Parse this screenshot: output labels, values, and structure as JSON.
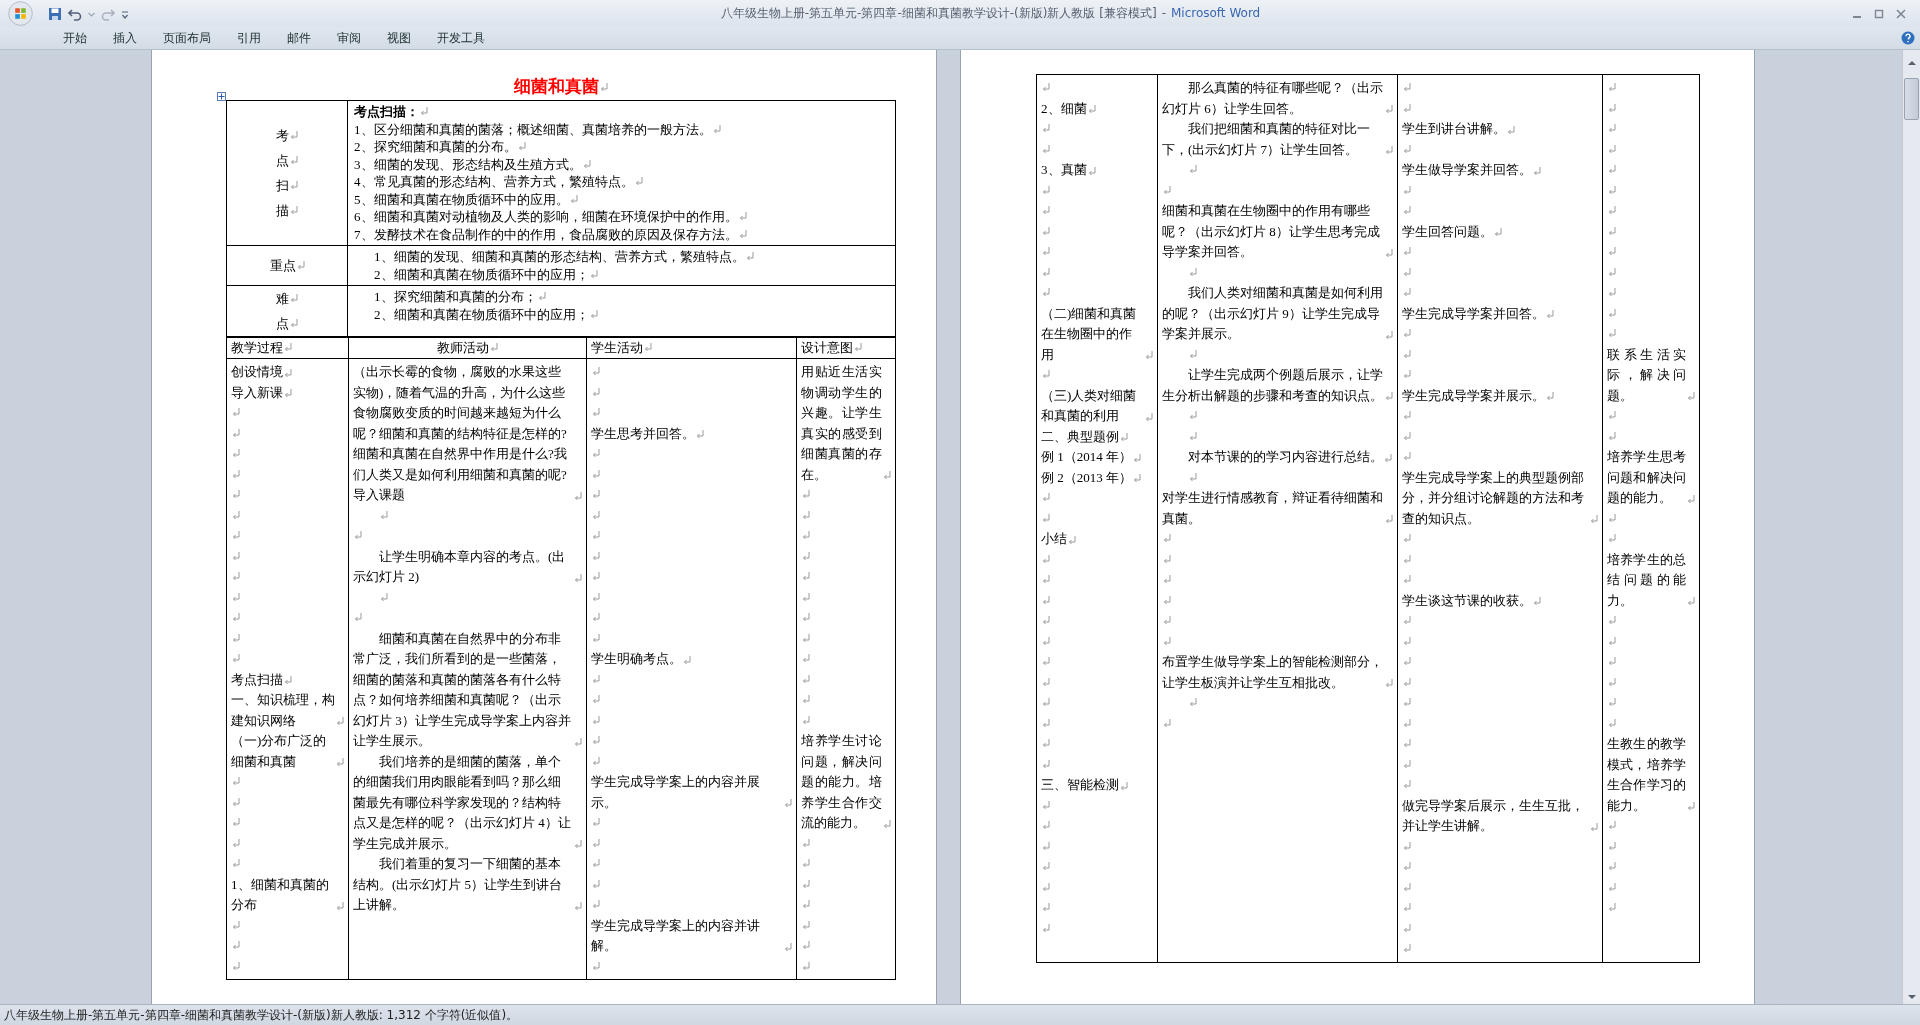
{
  "window": {
    "document_title": "八年级生物上册-第五单元-第四章-细菌和真菌教学设计-(新版)新人教版 [兼容模式]",
    "separator": "-",
    "app_name": "Microsoft Word"
  },
  "ribbon_tabs": [
    "开始",
    "插入",
    "页面布局",
    "引用",
    "邮件",
    "审阅",
    "视图",
    "开发工具"
  ],
  "document": {
    "title": "细菌和真菌",
    "summary_table": [
      {
        "label": [
          "考",
          "点",
          "扫",
          "描"
        ],
        "heading": "考点扫描：",
        "items": [
          "1、区分细菌和真菌的菌落；概述细菌、真菌培养的一般方法。",
          "2、探究细菌和真菌的分布。",
          "3、细菌的发现、形态结构及生殖方式。",
          "4、常见真菌的形态结构、营养方式，繁殖特点。",
          "5、细菌和真菌在物质循环中的应用。",
          "6、细菌和真菌对动植物及人类的影响，细菌在环境保护中的作用。",
          "7、发酵技术在食品制作的中的作用，食品腐败的原因及保存方法。"
        ]
      },
      {
        "label": [
          "重点"
        ],
        "items": [
          "1、细菌的发现、细菌和真菌的形态结构、营养方式，繁殖特点。",
          "2、细菌和真菌在物质循环中的应用；"
        ]
      },
      {
        "label": [
          "难",
          "点"
        ],
        "items": [
          "1、探究细菌和真菌的分布；",
          "2、细菌和真菌在物质循环中的应用；"
        ]
      }
    ],
    "lesson_table": {
      "columns": [
        "教学过程",
        "教师活动",
        "学生活动",
        "设计意图"
      ],
      "pages": [
        {
          "process": [
            {
              "text": "创设情境",
              "indent": false
            },
            {
              "text": "导入新课",
              "indent": false
            },
            {
              "indent": false
            },
            {
              "indent": false
            },
            {
              "indent": false
            },
            {
              "indent": false
            },
            {
              "indent": false
            },
            {
              "indent": false
            },
            {
              "indent": false
            },
            {
              "indent": false
            },
            {
              "indent": false
            },
            {
              "indent": false
            },
            {
              "indent": false
            },
            {
              "indent": false
            },
            {
              "indent": false
            },
            {
              "text": "考点扫描",
              "indent": false
            },
            {
              "text": "一、知识梳理，构建知识网络",
              "indent": false
            },
            {
              "text": "（一)分布广泛的细菌和真菌",
              "indent": false
            },
            {
              "indent": false
            },
            {
              "indent": false
            },
            {
              "indent": false
            },
            {
              "indent": false
            },
            {
              "indent": false
            },
            {
              "text": "1、细菌和真菌的分布",
              "indent": false
            },
            {
              "indent": false
            },
            {
              "indent": false
            },
            {
              "indent": false
            }
          ],
          "teacher": [
            {
              "text": "（出示长霉的食物，腐败的水果这些实物)，随着气温的升高，为什么这些食物腐败变质的时间越来越短为什么呢？细菌和真菌的结构特征是怎样的?细菌和真菌在自然界中作用是什么?我们人类又是如何利用细菌和真菌的呢?导入课题",
              "indent": false
            },
            {
              "indent": true
            },
            {
              "indent": false
            },
            {
              "text": "让学生明确本章内容的考点。(出示幻灯片 2)",
              "indent": true
            },
            {
              "indent": true
            },
            {
              "indent": false
            },
            {
              "text": "细菌和真菌在自然界中的分布非常广泛，我们所看到的是一些菌落，细菌的菌落和真菌的菌落各有什么特点？如何培养细菌和真菌呢？（出示幻灯片 3）让学生完成导学案上内容并让学生展示。",
              "indent": true
            },
            {
              "text": "我们培养的是细菌的菌落，单个的细菌我们用肉眼能看到吗？那么细菌最先有哪位科学家发现的？结构特点又是怎样的呢？（出示幻灯片 4）让学生完成并展示。",
              "indent": true
            },
            {
              "text": "我们着重的复习一下细菌的基本结构。(出示幻灯片 5）让学生到讲台上讲解。",
              "indent": true
            }
          ],
          "student": [
            {
              "indent": false
            },
            {
              "indent": false
            },
            {
              "indent": false
            },
            {
              "text": "学生思考并回答。",
              "indent": false
            },
            {
              "indent": false
            },
            {
              "indent": false
            },
            {
              "indent": false
            },
            {
              "indent": false
            },
            {
              "indent": false
            },
            {
              "indent": false
            },
            {
              "indent": false
            },
            {
              "indent": false
            },
            {
              "indent": false
            },
            {
              "indent": false
            },
            {
              "text": "学生明确考点。",
              "indent": false
            },
            {
              "indent": false
            },
            {
              "indent": false
            },
            {
              "indent": false
            },
            {
              "indent": false
            },
            {
              "indent": false
            },
            {
              "text": "学生完成导学案上的内容并展示。",
              "indent": false
            },
            {
              "indent": false
            },
            {
              "indent": false
            },
            {
              "indent": false
            },
            {
              "indent": false
            },
            {
              "indent": false
            },
            {
              "text": "学生完成导学案上的内容并讲解。",
              "indent": false
            },
            {
              "indent": false
            }
          ],
          "design": [
            {
              "text": "用贴近生活实物调动学生的兴趣。让学生真实的感受到细菌真菌的存在。",
              "indent": false
            },
            {
              "indent": false
            },
            {
              "indent": false
            },
            {
              "indent": false
            },
            {
              "indent": false
            },
            {
              "indent": false
            },
            {
              "indent": false
            },
            {
              "indent": false
            },
            {
              "indent": false
            },
            {
              "indent": false
            },
            {
              "indent": false
            },
            {
              "indent": false
            },
            {
              "indent": false
            },
            {
              "text": "培养学生讨论问题，解决问题的能力。培养学生合作交流的能力。",
              "indent": false
            },
            {
              "indent": false
            },
            {
              "indent": false
            },
            {
              "indent": false
            },
            {
              "indent": false
            },
            {
              "indent": false
            },
            {
              "indent": false
            },
            {
              "indent": false
            }
          ]
        },
        {
          "process": [
            {
              "indent": false
            },
            {
              "text": "2、细菌",
              "indent": false
            },
            {
              "indent": false
            },
            {
              "indent": false
            },
            {
              "text": "3、真菌",
              "indent": false
            },
            {
              "indent": false
            },
            {
              "indent": false
            },
            {
              "indent": false
            },
            {
              "indent": false
            },
            {
              "indent": false
            },
            {
              "indent": false
            },
            {
              "text": "（二)细菌和真菌在生物圈中的作用",
              "indent": false
            },
            {
              "indent": false
            },
            {
              "text": "（三)人类对细菌和真菌的利用",
              "indent": false
            },
            {
              "text": "二、典型题例",
              "indent": false
            },
            {
              "text": "例 1（2014 年）",
              "indent": false
            },
            {
              "text": "例 2（2013 年）",
              "indent": false
            },
            {
              "indent": false
            },
            {
              "indent": false
            },
            {
              "text": "小结",
              "indent": false
            },
            {
              "indent": false
            },
            {
              "indent": false
            },
            {
              "indent": false
            },
            {
              "indent": false
            },
            {
              "indent": false
            },
            {
              "indent": false
            },
            {
              "indent": false
            },
            {
              "indent": false
            },
            {
              "indent": false
            },
            {
              "indent": false
            },
            {
              "indent": false
            },
            {
              "text": "三、智能检测",
              "indent": false
            },
            {
              "indent": false
            },
            {
              "indent": false
            },
            {
              "indent": false
            },
            {
              "indent": false
            },
            {
              "indent": false
            },
            {
              "indent": false
            },
            {
              "indent": false
            }
          ],
          "teacher": [
            {
              "text": "那么真菌的特征有哪些呢？（出示幻灯片 6）让学生回答。",
              "indent": true
            },
            {
              "text": "我们把细菌和真菌的特征对比一下，(出示幻灯片 7）让学生回答。",
              "indent": true
            },
            {
              "indent": true
            },
            {
              "indent": false
            },
            {
              "text": "细菌和真菌在生物圈中的作用有哪些呢？（出示幻灯片 8）让学生思考完成导学案并回答。",
              "indent": false
            },
            {
              "indent": true
            },
            {
              "text": "我们人类对细菌和真菌是如何利用的呢？（出示幻灯片 9）让学生完成导学案并展示。",
              "indent": true
            },
            {
              "indent": true
            },
            {
              "text": "让学生完成两个例题后展示，让学生分析出解题的步骤和考查的知识点。",
              "indent": true
            },
            {
              "indent": true
            },
            {
              "indent": true
            },
            {
              "text": "对本节课的的学习内容进行总结。",
              "indent": true
            },
            {
              "indent": true
            },
            {
              "text": "对学生进行情感教育，辩证看待细菌和真菌。",
              "indent": false
            },
            {
              "indent": false
            },
            {
              "indent": false
            },
            {
              "indent": false
            },
            {
              "indent": false
            },
            {
              "indent": false
            },
            {
              "indent": false
            },
            {
              "text": "布置学生做导学案上的智能检测部分，让学生板演并让学生互相批改。",
              "indent": false
            },
            {
              "indent": true
            },
            {
              "indent": false
            }
          ],
          "student": [
            {
              "indent": false
            },
            {
              "indent": false
            },
            {
              "text": "学生到讲台讲解。",
              "indent": false
            },
            {
              "indent": false
            },
            {
              "text": "学生做导学案并回答。",
              "indent": false
            },
            {
              "indent": false
            },
            {
              "indent": false
            },
            {
              "text": "学生回答问题。",
              "indent": false
            },
            {
              "indent": false
            },
            {
              "indent": false
            },
            {
              "indent": false
            },
            {
              "text": "学生完成导学案并回答。",
              "indent": false
            },
            {
              "indent": false
            },
            {
              "indent": false
            },
            {
              "indent": false
            },
            {
              "text": "学生完成导学案并展示。",
              "indent": false
            },
            {
              "indent": false
            },
            {
              "indent": false
            },
            {
              "indent": false
            },
            {
              "text": "学生完成导学案上的典型题例部分，并分组讨论解题的方法和考查的知识点。",
              "indent": false
            },
            {
              "indent": false
            },
            {
              "indent": false
            },
            {
              "indent": false
            },
            {
              "text": "学生谈这节课的收获。",
              "indent": false
            },
            {
              "indent": false
            },
            {
              "indent": false
            },
            {
              "indent": false
            },
            {
              "indent": false
            },
            {
              "indent": false
            },
            {
              "indent": false
            },
            {
              "indent": false
            },
            {
              "indent": false
            },
            {
              "indent": false
            },
            {
              "text": "做完导学案后展示，生生互批，并让学生讲解。",
              "indent": false
            },
            {
              "indent": false
            },
            {
              "indent": false
            },
            {
              "indent": false
            },
            {
              "indent": false
            },
            {
              "indent": false
            },
            {
              "indent": false
            }
          ],
          "design": [
            {
              "indent": false
            },
            {
              "indent": false
            },
            {
              "indent": false
            },
            {
              "indent": false
            },
            {
              "indent": false
            },
            {
              "indent": false
            },
            {
              "indent": false
            },
            {
              "indent": false
            },
            {
              "indent": false
            },
            {
              "indent": false
            },
            {
              "indent": false
            },
            {
              "indent": false
            },
            {
              "indent": false
            },
            {
              "text": "联系生活实际，解决问题。",
              "indent": false
            },
            {
              "indent": false
            },
            {
              "indent": false
            },
            {
              "text": "培养学生思考问题和解决问题的能力。",
              "indent": false
            },
            {
              "indent": false
            },
            {
              "indent": false
            },
            {
              "text": "培养学生的总结问题的能力。",
              "indent": false
            },
            {
              "indent": false
            },
            {
              "indent": false
            },
            {
              "indent": false
            },
            {
              "indent": false
            },
            {
              "indent": false
            },
            {
              "indent": false
            },
            {
              "text": "生教生的教学模式，培养学生合作学习的能力。",
              "indent": false
            },
            {
              "indent": false
            },
            {
              "indent": false
            },
            {
              "indent": false
            },
            {
              "indent": false
            },
            {
              "indent": false
            }
          ]
        }
      ]
    }
  },
  "status_bar": {
    "text": "八年级生物上册-第五单元-第四章-细菌和真菌教学设计-(新版)新人教版: 1,312 个字符(近似值)。"
  }
}
